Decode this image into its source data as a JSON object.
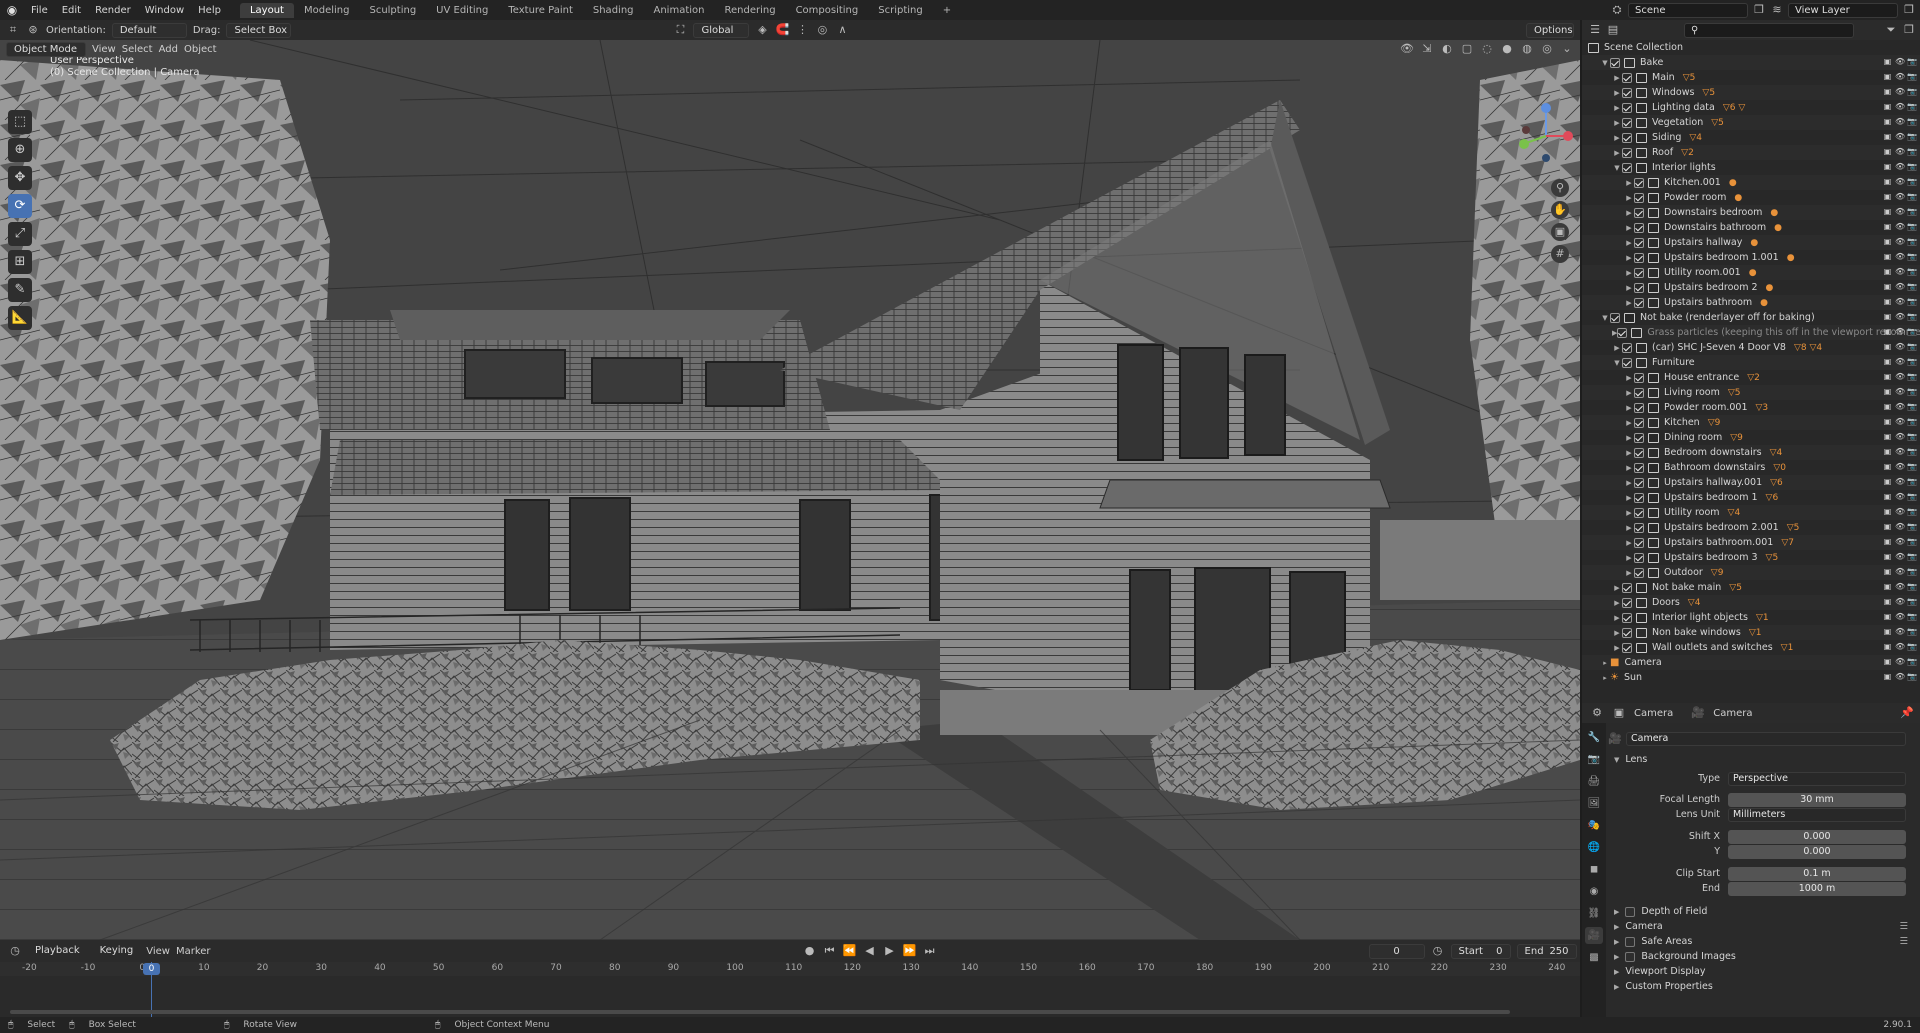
{
  "app": {
    "menus": [
      "File",
      "Edit",
      "Render",
      "Window",
      "Help"
    ],
    "workspaces": [
      "Layout",
      "Modeling",
      "Sculpting",
      "UV Editing",
      "Texture Paint",
      "Shading",
      "Animation",
      "Rendering",
      "Compositing",
      "Scripting"
    ],
    "active_workspace": "Layout",
    "scene_field": "Scene",
    "view_layer_field": "View Layer"
  },
  "viewport": {
    "orientation_label": "Orientation:",
    "orientation_value": "Default",
    "drag_label": "Drag:",
    "drag_value": "Select Box",
    "transform_space": "Global",
    "options_label": "Options",
    "mode": "Object Mode",
    "header_menus": [
      "View",
      "Select",
      "Add",
      "Object"
    ],
    "perspective_text": "User Perspective",
    "collection_text": "(0) Scene Collection | Camera"
  },
  "timeline": {
    "menus": [
      "Playback",
      "Keying",
      "View",
      "Marker"
    ],
    "current_frame": "0",
    "start_label": "Start",
    "start_value": "0",
    "end_label": "End",
    "end_value": "250",
    "ruler": [
      "-20",
      "-10",
      "0",
      "10",
      "20",
      "30",
      "40",
      "50",
      "60",
      "70",
      "80",
      "90",
      "100",
      "110",
      "120",
      "130",
      "140",
      "150",
      "160",
      "170",
      "180",
      "190",
      "200",
      "210",
      "220",
      "230",
      "240"
    ],
    "playhead_value": "0"
  },
  "statusbar": {
    "items": [
      "Select",
      "Box Select",
      "Rotate View",
      "Object Context Menu"
    ],
    "version": "2.90.1"
  },
  "outliner": {
    "root": "Scene Collection",
    "rows": [
      {
        "label": "Bake",
        "depth": 1,
        "type": "collection",
        "open": true
      },
      {
        "label": "Main",
        "depth": 2,
        "type": "collection",
        "extra": "▽5"
      },
      {
        "label": "Windows",
        "depth": 2,
        "type": "collection",
        "extra": "▽5"
      },
      {
        "label": "Lighting data",
        "depth": 2,
        "type": "collection",
        "extra": "▽6 ▽"
      },
      {
        "label": "Vegetation",
        "depth": 2,
        "type": "collection",
        "extra": "▽5"
      },
      {
        "label": "Siding",
        "depth": 2,
        "type": "collection",
        "extra": "▽4"
      },
      {
        "label": "Roof",
        "depth": 2,
        "type": "collection",
        "extra": "▽2"
      },
      {
        "label": "Interior lights",
        "depth": 2,
        "type": "collection",
        "open": true
      },
      {
        "label": "Kitchen.001",
        "depth": 3,
        "type": "collection",
        "extra": "●"
      },
      {
        "label": "Powder room",
        "depth": 3,
        "type": "collection",
        "extra": "●"
      },
      {
        "label": "Downstairs bedroom",
        "depth": 3,
        "type": "collection",
        "extra": "●"
      },
      {
        "label": "Downstairs bathroom",
        "depth": 3,
        "type": "collection",
        "extra": "●"
      },
      {
        "label": "Upstairs hallway",
        "depth": 3,
        "type": "collection",
        "extra": "●"
      },
      {
        "label": "Upstairs bedroom 1.001",
        "depth": 3,
        "type": "collection",
        "extra": "●"
      },
      {
        "label": "Utility room.001",
        "depth": 3,
        "type": "collection",
        "extra": "●"
      },
      {
        "label": "Upstairs bedroom 2",
        "depth": 3,
        "type": "collection",
        "extra": "●"
      },
      {
        "label": "Upstairs bathroom",
        "depth": 3,
        "type": "collection",
        "extra": "●"
      },
      {
        "label": "Not bake (renderlayer off for baking)",
        "depth": 1,
        "type": "collection",
        "open": true
      },
      {
        "label": "Grass particles (keeping this off in the viewport recommend",
        "depth": 2,
        "type": "collection",
        "dim": true
      },
      {
        "label": "(car) SHC J-Seven 4 Door V8",
        "depth": 2,
        "type": "collection",
        "extra": "▽8 ▽4"
      },
      {
        "label": "Furniture",
        "depth": 2,
        "type": "collection",
        "open": true
      },
      {
        "label": "House entrance",
        "depth": 3,
        "type": "collection",
        "extra": "▽2"
      },
      {
        "label": "Living room",
        "depth": 3,
        "type": "collection",
        "extra": "▽5"
      },
      {
        "label": "Powder room.001",
        "depth": 3,
        "type": "collection",
        "extra": "▽3"
      },
      {
        "label": "Kitchen",
        "depth": 3,
        "type": "collection",
        "extra": "▽9"
      },
      {
        "label": "Dining room",
        "depth": 3,
        "type": "collection",
        "extra": "▽9"
      },
      {
        "label": "Bedroom downstairs",
        "depth": 3,
        "type": "collection",
        "extra": "▽4"
      },
      {
        "label": "Bathroom downstairs",
        "depth": 3,
        "type": "collection",
        "extra": "▽0"
      },
      {
        "label": "Upstairs hallway.001",
        "depth": 3,
        "type": "collection",
        "extra": "▽6"
      },
      {
        "label": "Upstairs bedroom 1",
        "depth": 3,
        "type": "collection",
        "extra": "▽6"
      },
      {
        "label": "Utility room",
        "depth": 3,
        "type": "collection",
        "extra": "▽4"
      },
      {
        "label": "Upstairs bedroom 2.001",
        "depth": 3,
        "type": "collection",
        "extra": "▽5"
      },
      {
        "label": "Upstairs bathroom.001",
        "depth": 3,
        "type": "collection",
        "extra": "▽7"
      },
      {
        "label": "Upstairs bedroom 3",
        "depth": 3,
        "type": "collection",
        "extra": "▽5"
      },
      {
        "label": "Outdoor",
        "depth": 3,
        "type": "collection",
        "extra": "▽9"
      },
      {
        "label": "Not bake main",
        "depth": 2,
        "type": "collection",
        "extra": "▽5"
      },
      {
        "label": "Doors",
        "depth": 2,
        "type": "collection",
        "extra": "▽4"
      },
      {
        "label": "Interior light objects",
        "depth": 2,
        "type": "collection",
        "extra": "▽1"
      },
      {
        "label": "Non bake windows",
        "depth": 2,
        "type": "collection",
        "extra": "▽1"
      },
      {
        "label": "Wall outlets and switches",
        "depth": 2,
        "type": "collection",
        "extra": "▽1"
      },
      {
        "label": "Camera",
        "depth": 1,
        "type": "object"
      },
      {
        "label": "Sun",
        "depth": 1,
        "type": "object"
      }
    ]
  },
  "properties": {
    "header_object": "Camera",
    "header_data": "Camera",
    "datablock": "Camera",
    "lens_section": "Lens",
    "type_label": "Type",
    "type_value": "Perspective",
    "focal_label": "Focal Length",
    "focal_value": "30 mm",
    "lens_unit_label": "Lens Unit",
    "lens_unit_value": "Millimeters",
    "shift_x_label": "Shift X",
    "shift_x_value": "0.000",
    "shift_y_label": "Y",
    "shift_y_value": "0.000",
    "clip_start_label": "Clip Start",
    "clip_start_value": "0.1 m",
    "clip_end_label": "End",
    "clip_end_value": "1000 m",
    "sections": [
      {
        "label": "Depth of Field",
        "checkbox": true
      },
      {
        "label": "Camera",
        "checkbox": false
      },
      {
        "label": "Safe Areas",
        "checkbox": true
      },
      {
        "label": "Background Images",
        "checkbox": true
      },
      {
        "label": "Viewport Display",
        "checkbox": false
      },
      {
        "label": "Custom Properties",
        "checkbox": false
      }
    ]
  },
  "colors": {
    "accent": "#4772b3",
    "viewport_bg": "#404040",
    "playhead": "#4772b3",
    "object_orange": "#e8923a"
  }
}
